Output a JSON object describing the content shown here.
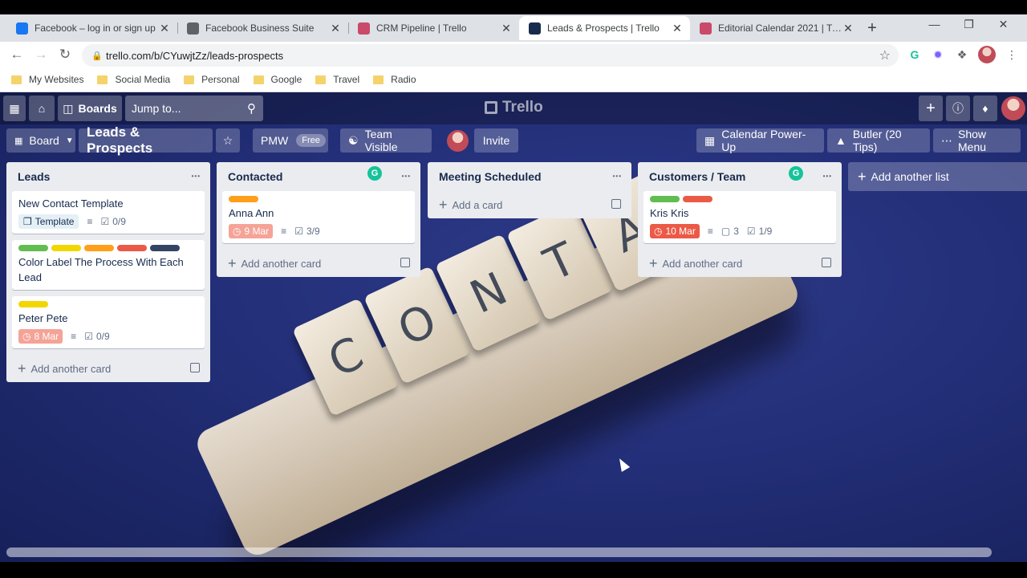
{
  "browser": {
    "tabs": [
      {
        "title": "Facebook – log in or sign up",
        "favicon": "facebook-icon",
        "color": "#1877f2",
        "active": false
      },
      {
        "title": "Facebook Business Suite",
        "favicon": "business-suite-icon",
        "color": "#5f6368",
        "active": false
      },
      {
        "title": "CRM Pipeline | Trello",
        "favicon": "trello-icon",
        "color": "#c94a6a",
        "active": false
      },
      {
        "title": "Leads & Prospects | Trello",
        "favicon": "trello-icon",
        "color": "#172b4d",
        "active": true
      },
      {
        "title": "Editorial Calendar 2021 | Trello",
        "favicon": "trello-icon",
        "color": "#c94a6a",
        "active": false
      }
    ],
    "url": "trello.com/b/CYuwjtZz/leads-prospects",
    "bookmarks": [
      "My Websites",
      "Social Media",
      "Personal",
      "Google",
      "Travel",
      "Radio"
    ]
  },
  "header": {
    "boards_label": "Boards",
    "search_placeholder": "Jump to...",
    "logo_text": "Trello"
  },
  "board": {
    "view_label": "Board",
    "title": "Leads & Prospects",
    "team_name": "PMW",
    "team_badge": "Free",
    "visibility_label": "Team Visible",
    "invite_label": "Invite",
    "calendar_label": "Calendar Power-Up",
    "butler_label": "Butler (20 Tips)",
    "menu_label": "Show Menu",
    "add_list_label": "Add another list"
  },
  "lists": [
    {
      "name": "Leads",
      "add_label": "Add another card",
      "cards": [
        {
          "title": "New Contact Template",
          "labels": [],
          "template": "Template",
          "checklist": "0/9"
        },
        {
          "title": "Color Label The Process With Each Lead",
          "labels": [
            "#61bd4f",
            "#f2d600",
            "#ff9f1a",
            "#eb5a46",
            "#344563"
          ]
        },
        {
          "title": "Peter Pete",
          "labels": [
            "#f2d600"
          ],
          "due": "8 Mar",
          "checklist": "0/9"
        }
      ]
    },
    {
      "name": "Contacted",
      "add_label": "Add another card",
      "cards": [
        {
          "title": "Anna Ann",
          "labels": [
            "#ff9f1a"
          ],
          "due": "9 Mar",
          "checklist": "3/9"
        }
      ]
    },
    {
      "name": "Meeting Scheduled",
      "add_label": "Add a card",
      "cards": []
    },
    {
      "name": "Customers / Team",
      "add_label": "Add another card",
      "cards": [
        {
          "title": "Kris Kris",
          "labels": [
            "#61bd4f",
            "#eb5a46"
          ],
          "due": "10 Mar",
          "comments": "3",
          "checklist": "1/9"
        }
      ]
    }
  ],
  "background_tiles": [
    "C",
    "O",
    "N",
    "T",
    "A"
  ]
}
